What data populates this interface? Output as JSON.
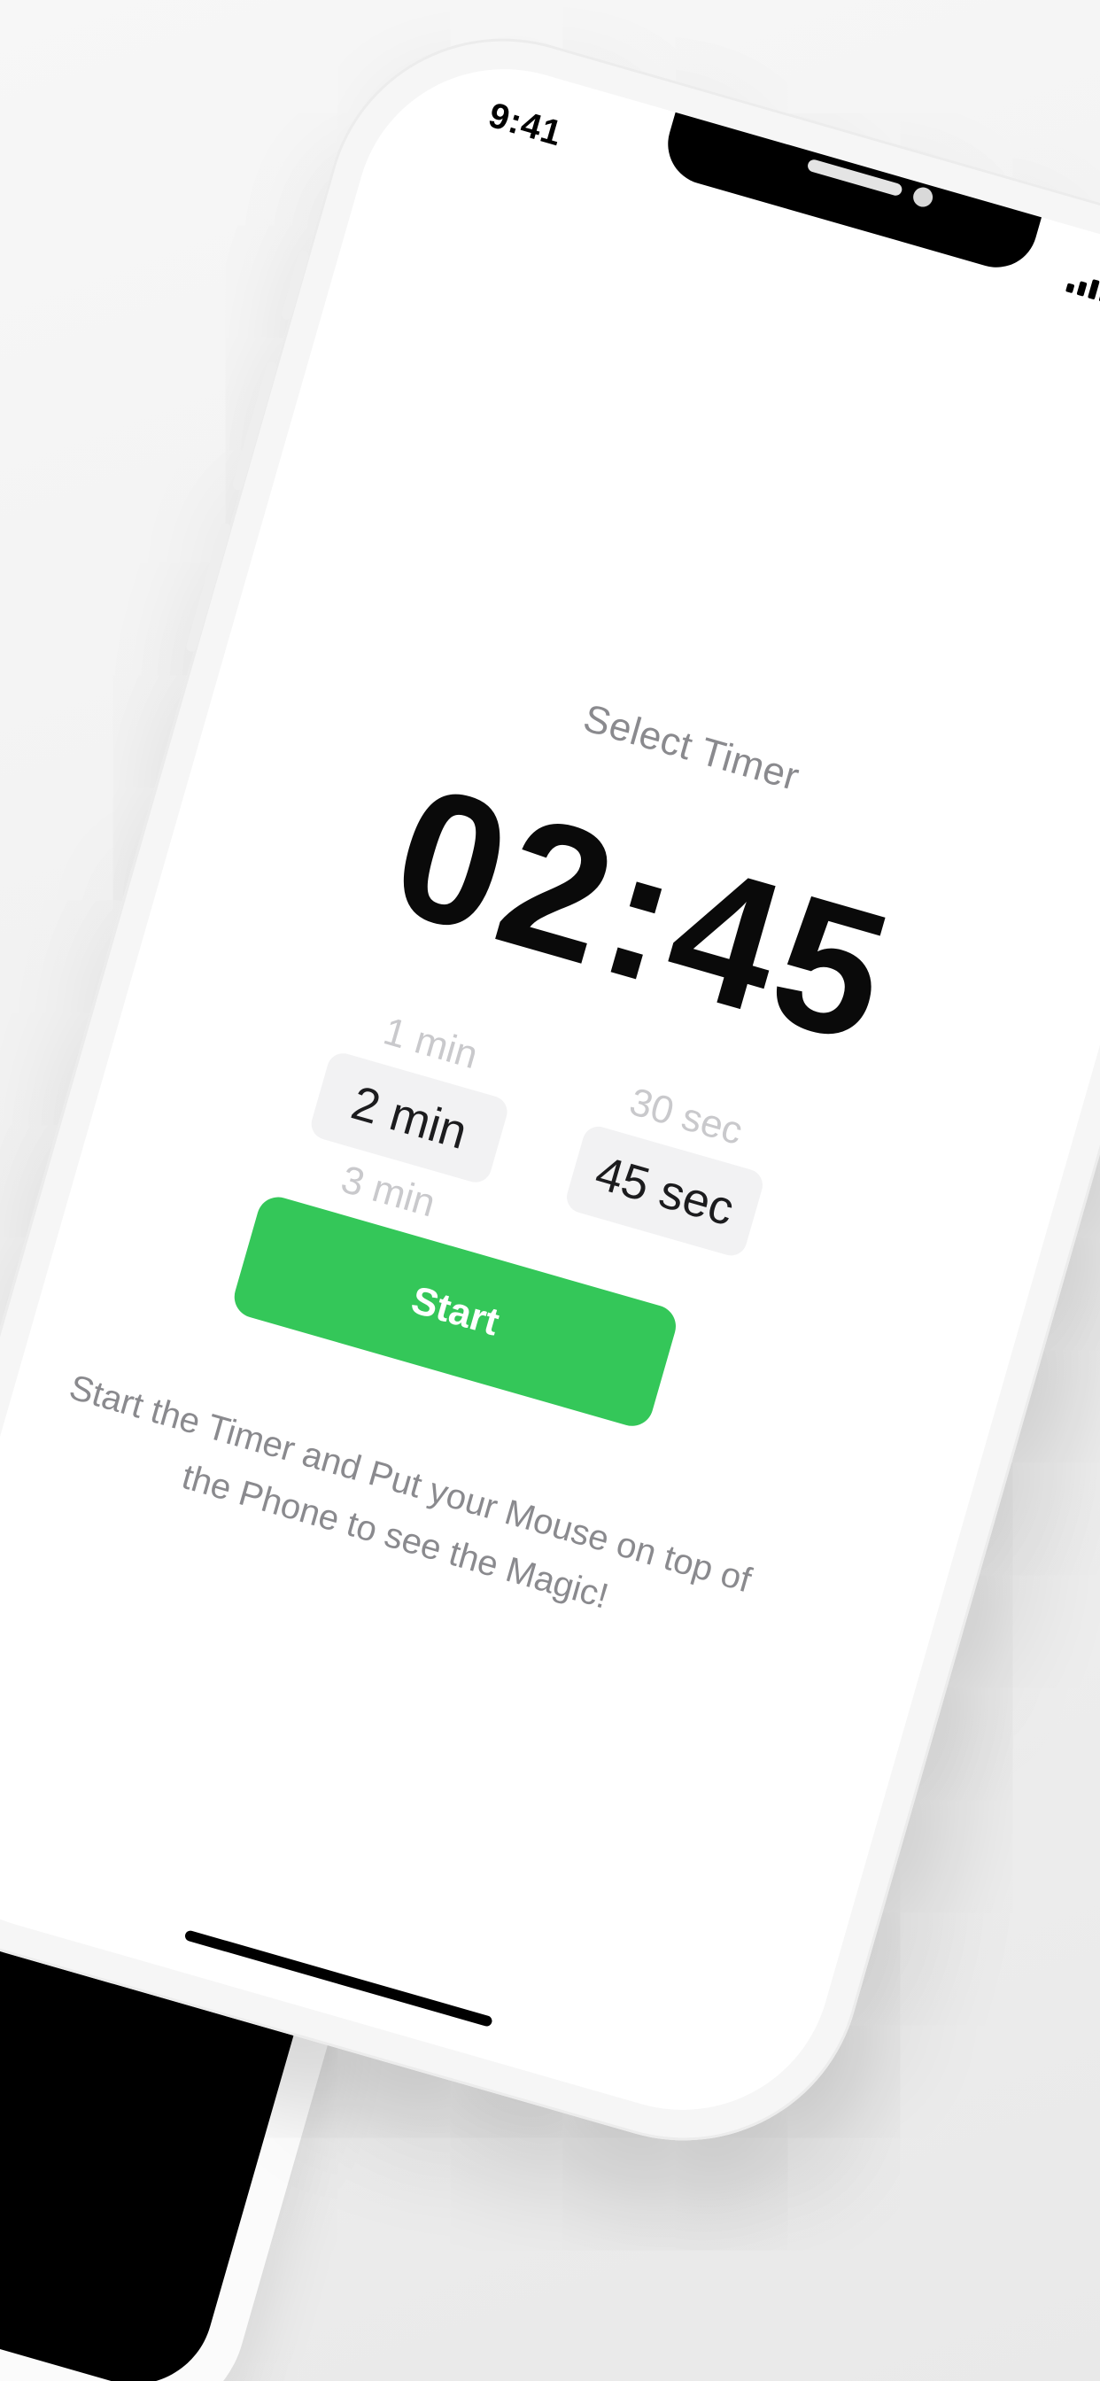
{
  "status_bar": {
    "time": "9:41",
    "icons": [
      "cellular-signal-icon",
      "wifi-icon",
      "battery-icon"
    ]
  },
  "main": {
    "title": "Select Timer",
    "timer_display": "02:45",
    "minutes_picker": {
      "items": [
        "1 min",
        "2 min",
        "3 min"
      ],
      "selected": "2 min"
    },
    "seconds_picker": {
      "items": [
        "30 sec",
        "45 sec"
      ],
      "selected": "45 sec"
    },
    "start_label": "Start",
    "instructions": "Start the Timer and Put your Mouse on top of the Phone to see the Magic!"
  },
  "colors": {
    "accent": "#34C759",
    "title_text": "#8A8A8E",
    "timer_text": "#0A0A0A",
    "picker_selected_bg": "#F2F2F3",
    "picker_faded_text": "#C9C9CC"
  }
}
